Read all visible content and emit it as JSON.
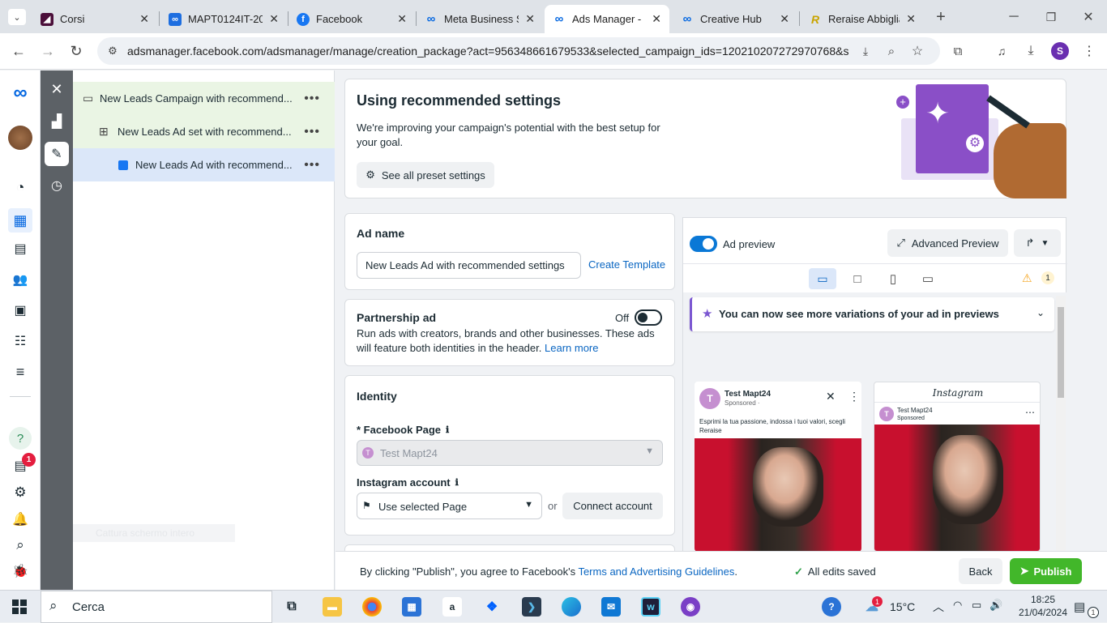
{
  "browser": {
    "tabs": [
      {
        "title": "Corsi",
        "icon": "moodle-icon",
        "color": "#4b0f3a"
      },
      {
        "title": "MAPT0124IT-20",
        "icon": "meta-blueprint-icon",
        "color": "#1d6ee0"
      },
      {
        "title": "Facebook",
        "icon": "facebook-icon",
        "color": "#1877f2"
      },
      {
        "title": "Meta Business S",
        "icon": "meta-icon",
        "color": "#0668e1"
      },
      {
        "title": "Ads Manager - ",
        "icon": "meta-icon",
        "color": "#0668e1"
      },
      {
        "title": "Creative Hub",
        "icon": "meta-icon",
        "color": "#0668e1"
      },
      {
        "title": "Reraise Abbiglia",
        "icon": "reraise-icon",
        "color": "#c9a400"
      }
    ],
    "url": "adsmanager.facebook.com/adsmanager/manage/creation_package?act=956348661679533&selected_campaign_ids=120210207272970768&se...",
    "profile_initial": "S"
  },
  "rail": {
    "badge_count": "1"
  },
  "tree": {
    "campaign": "New Leads Campaign with recommend...",
    "adset": "New Leads Ad set with recommend...",
    "ad": "New Leads Ad with recommend...",
    "ghost": "Cattura schermo intero"
  },
  "recommended": {
    "title": "Using recommended settings",
    "desc": "We're improving your campaign's potential with the best setup for your goal.",
    "button": "See all preset settings"
  },
  "adname": {
    "label": "Ad name",
    "value": "New Leads Ad with recommended settings",
    "template_link": "Create Template"
  },
  "partnership": {
    "title": "Partnership ad",
    "state": "Off",
    "desc": "Run ads with creators, brands and other businesses. These ads will feature both identities in the header.",
    "learn": "Learn more"
  },
  "identity": {
    "title": "Identity",
    "fb_page_label": "* Facebook Page",
    "fb_page_value": "Test Mapt24",
    "fb_page_initial": "T",
    "ig_label": "Instagram account",
    "ig_value": "Use selected Page",
    "or": "or",
    "connect": "Connect account"
  },
  "preview": {
    "toggle_label": "Ad preview",
    "advanced": "Advanced Preview",
    "warning_count": "1",
    "banner": "You can now see more variations of your ad in previews",
    "fb": {
      "page": "Test Mapt24",
      "sponsored": "Sponsored · ",
      "text": "Esprimi la tua passione, indossa i tuoi valori, scegli Reraise",
      "initial": "T"
    },
    "ig": {
      "brand": "Instagram",
      "page": "Test Mapt24",
      "sponsored": "Sponsored",
      "initial": "T"
    }
  },
  "footer": {
    "prefix": "By clicking \"Publish\", you agree to Facebook's ",
    "terms": "Terms and Advertising Guidelines",
    "suffix": ".",
    "saved": "All edits saved",
    "back": "Back",
    "publish": "Publish"
  },
  "taskbar": {
    "search": "Cerca",
    "weather_badge": "1",
    "temp": "15°C",
    "time": "18:25",
    "date": "21/04/2024",
    "notif": "1"
  },
  "colors": {
    "meta_blue": "#0668e1",
    "publish_green": "#42b72a",
    "selected_row": "#dbe7f9",
    "campaign_row": "#eaf5e4",
    "link": "#0a66c2"
  }
}
